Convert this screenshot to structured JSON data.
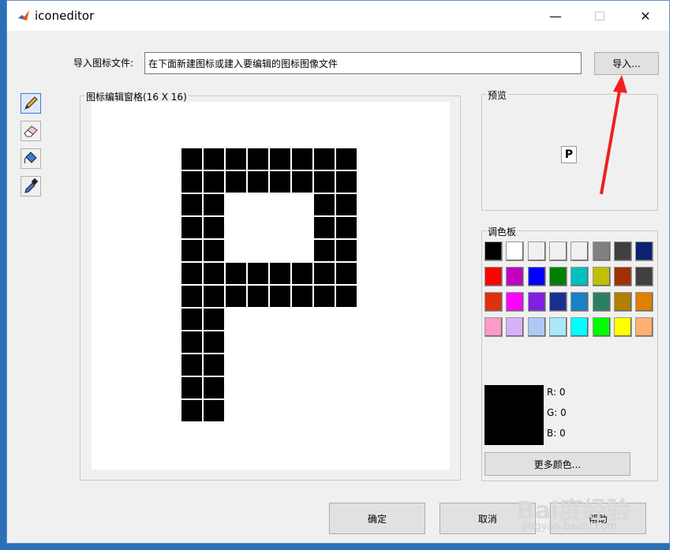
{
  "window": {
    "title": "iconeditor"
  },
  "import": {
    "label": "导入图标文件:",
    "value": "在下面新建图标或建入要编辑的图标图像文件",
    "button": "导入..."
  },
  "editor": {
    "label": "图标编辑窗格(16 X 16)",
    "grid": [
      [
        1,
        1,
        1,
        1,
        1,
        1,
        1,
        1
      ],
      [
        1,
        1,
        1,
        1,
        1,
        1,
        1,
        1
      ],
      [
        1,
        1,
        0,
        0,
        0,
        0,
        1,
        1
      ],
      [
        1,
        1,
        0,
        0,
        0,
        0,
        1,
        1
      ],
      [
        1,
        1,
        0,
        0,
        0,
        0,
        1,
        1
      ],
      [
        1,
        1,
        1,
        1,
        1,
        1,
        1,
        1
      ],
      [
        1,
        1,
        1,
        1,
        1,
        1,
        1,
        1
      ],
      [
        1,
        1,
        0,
        0,
        0,
        0,
        0,
        0
      ],
      [
        1,
        1,
        0,
        0,
        0,
        0,
        0,
        0
      ],
      [
        1,
        1,
        0,
        0,
        0,
        0,
        0,
        0
      ],
      [
        1,
        1,
        0,
        0,
        0,
        0,
        0,
        0
      ],
      [
        1,
        1,
        0,
        0,
        0,
        0,
        0,
        0
      ]
    ]
  },
  "tools": [
    {
      "name": "pencil-tool",
      "icon": "pencil-icon",
      "selected": true
    },
    {
      "name": "eraser-tool",
      "icon": "eraser-icon",
      "selected": false
    },
    {
      "name": "fill-tool",
      "icon": "paint-bucket-icon",
      "selected": false
    },
    {
      "name": "eyedropper-tool",
      "icon": "eyedropper-icon",
      "selected": false
    }
  ],
  "preview": {
    "label": "预览",
    "glyph": "P"
  },
  "palette": {
    "label": "调色板",
    "colors": [
      [
        "#000000",
        "#ffffff",
        "#f0f0f0",
        "#f0f0f0",
        "#f0f0f0",
        "#808080",
        "#404040",
        "#0a2270"
      ],
      [
        "#ff0000",
        "#c000c0",
        "#0000ff",
        "#008000",
        "#00c0c0",
        "#c0c000",
        "#a03000",
        "#404040"
      ],
      [
        "#e03010",
        "#ff00ff",
        "#8020e0",
        "#1a3090",
        "#1a80c8",
        "#2a8060",
        "#b08000",
        "#e08000"
      ],
      [
        "#ff99c8",
        "#d8b0f8",
        "#b0c8f8",
        "#a8e8f8",
        "#00ffff",
        "#00ff00",
        "#ffff00",
        "#ffb070"
      ]
    ],
    "current_color": "#000000",
    "r": "R: 0",
    "g": "G: 0",
    "b": "B: 0",
    "more_button": "更多颜色..."
  },
  "footer": {
    "ok": "确定",
    "cancel": "取消",
    "help": "帮助"
  },
  "watermark": {
    "text": "Bai度经验",
    "url": "jingyan.baidu.com"
  }
}
